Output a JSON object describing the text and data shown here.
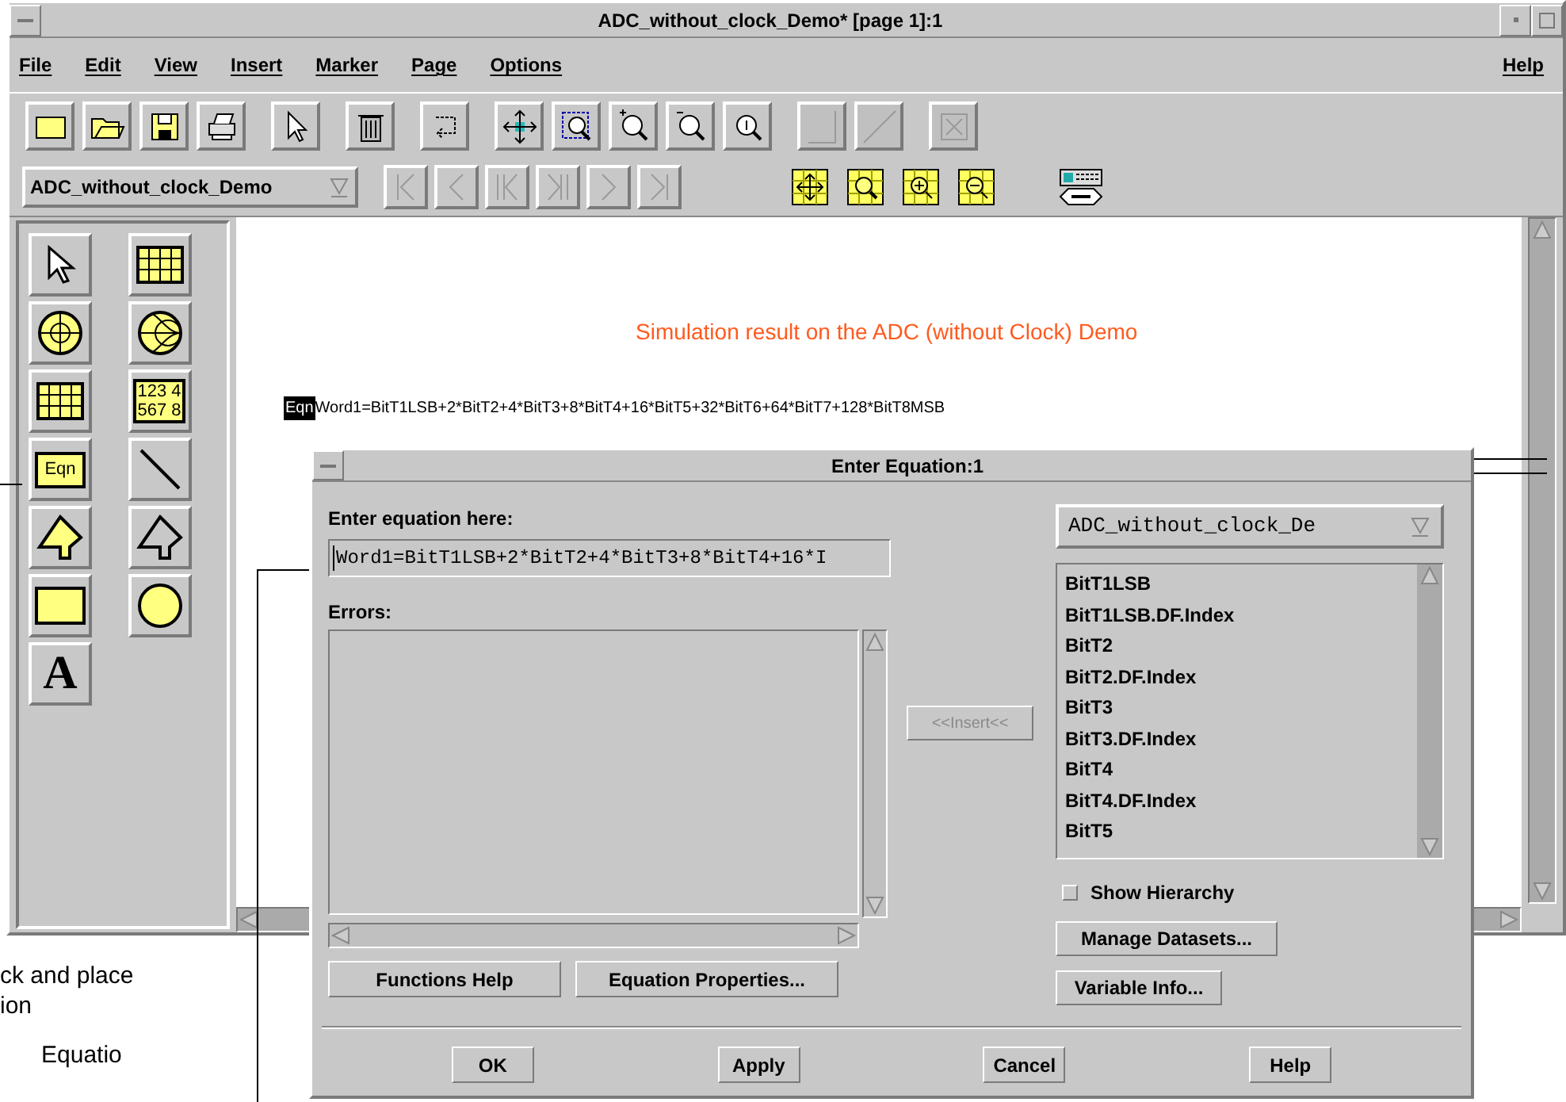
{
  "window": {
    "title": "ADC_without_clock_Demo* [page 1]:1"
  },
  "menu_bar": {
    "items": [
      "File",
      "Edit",
      "View",
      "Insert",
      "Marker",
      "Page",
      "Options"
    ],
    "help": "Help"
  },
  "toolbar": [
    [
      {
        "kind": "new",
        "disabled": false
      },
      {
        "kind": "open",
        "disabled": false
      },
      {
        "kind": "save",
        "disabled": false
      },
      {
        "kind": "print",
        "disabled": false
      }
    ],
    [
      {
        "kind": "pointer",
        "disabled": false
      }
    ],
    [
      {
        "kind": "delete",
        "disabled": false
      }
    ],
    [
      {
        "kind": "undo",
        "disabled": false
      }
    ],
    [
      {
        "kind": "move",
        "disabled": false
      },
      {
        "kind": "zoom-box",
        "disabled": false
      },
      {
        "kind": "zoom-in",
        "disabled": false
      },
      {
        "kind": "zoom-out",
        "disabled": false
      },
      {
        "kind": "zoom-fit",
        "disabled": false
      }
    ],
    [
      {
        "kind": "corner",
        "disabled": true
      },
      {
        "kind": "diagonal",
        "disabled": true
      }
    ],
    [
      {
        "kind": "box-x",
        "disabled": true
      }
    ]
  ],
  "nav_bar": {
    "dataset": "ADC_without_clock_Demo",
    "nav_buttons": [
      {
        "kind": "first",
        "disabled": true
      },
      {
        "kind": "prev",
        "disabled": true
      },
      {
        "kind": "prev-page",
        "disabled": true
      },
      {
        "kind": "next-page",
        "disabled": true
      },
      {
        "kind": "next",
        "disabled": true
      },
      {
        "kind": "last",
        "disabled": true
      }
    ],
    "view_buttons": [
      {
        "kind": "move"
      },
      {
        "kind": "zoom-box"
      },
      {
        "kind": "zoom-in"
      },
      {
        "kind": "zoom-out"
      }
    ]
  },
  "palette": [
    {
      "kind": "pointer"
    },
    {
      "kind": "grid"
    },
    {
      "kind": "polar"
    },
    {
      "kind": "smith"
    },
    {
      "kind": "table"
    },
    {
      "kind": "list",
      "label": "123 4",
      "label_2": "567 8"
    },
    {
      "kind": "equation",
      "label": "Eqn"
    },
    {
      "kind": "line"
    },
    {
      "kind": "arrow"
    },
    {
      "kind": "arrow-outline"
    },
    {
      "kind": "rect"
    },
    {
      "kind": "circle"
    },
    {
      "kind": "text",
      "label": "A"
    }
  ],
  "canvas": {
    "title": "Simulation result on the ADC (without Clock) Demo",
    "equation_tag": "Eqn",
    "equation": "Word1=BitT1LSB+2*BitT2+4*BitT3+8*BitT4+16*BitT5+32*BitT6+64*BitT7+128*BitT8MSB"
  },
  "dialog": {
    "title": "Enter Equation:1",
    "equation_label": "Enter equation here:",
    "equation_value": "Word1=BitT1LSB+2*BitT2+4*BitT3+8*BitT4+16*I",
    "errors_label": "Errors:",
    "insert_button": {
      "label": "<<Insert<<",
      "disabled": true
    },
    "dataset": "ADC_without_clock_De",
    "variables": [
      "BitT1LSB",
      "BitT1LSB.DF.Index",
      "BitT2",
      "BitT2.DF.Index",
      "BitT3",
      "BitT3.DF.Index",
      "BitT4",
      "BitT4.DF.Index",
      "BitT5"
    ],
    "show_hierarchy": {
      "label": "Show Hierarchy",
      "checked": false
    },
    "side_buttons": [
      "Manage Datasets...",
      "Variable Info..."
    ],
    "left_buttons": [
      "Functions Help",
      "Equation Properties..."
    ],
    "footer_buttons": [
      "OK",
      "Apply",
      "Cancel",
      "Help"
    ]
  },
  "annotations": [
    "ck and place",
    "ion",
    "Equatio"
  ]
}
